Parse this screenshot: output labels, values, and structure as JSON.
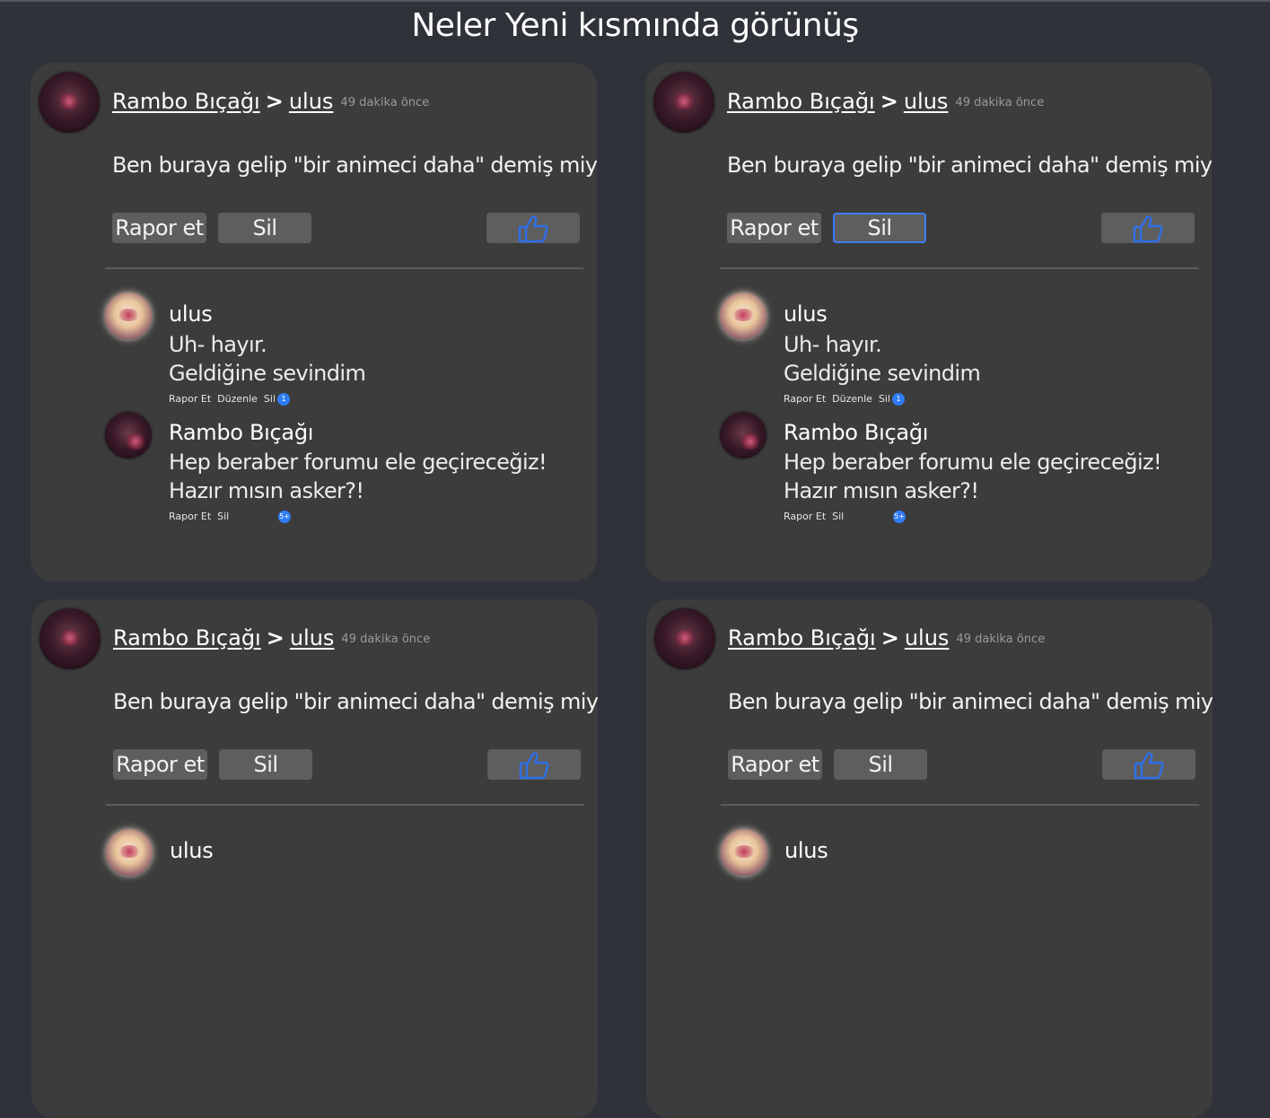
{
  "page": {
    "title": "Neler Yeni kısmında görünüş"
  },
  "colors": {
    "background": "#2f3239",
    "card": "#3c3c3c",
    "button": "#5e5e5e",
    "accent_blue": "#3f7bff",
    "badge": "#2f7cf6"
  },
  "post": {
    "author": "Rambo Bıçağı",
    "arrow": ">",
    "target": "ulus",
    "time": "49 dakika önce",
    "text": "Ben buraya gelip \"bir animeci daha\" demiş miydim?",
    "report_label": "Rapor et",
    "delete_label": "Sil",
    "like_icon": "thumbs-up-icon"
  },
  "comments": [
    {
      "author": "ulus",
      "lines": [
        "Uh- hayır.",
        "Geldiğine sevindim"
      ],
      "actions": [
        "Rapor Et",
        "Düzenle",
        "Sil"
      ],
      "badge": "1"
    },
    {
      "author": "Rambo Bıçağı",
      "lines": [
        "Hep beraber forumu ele geçireceğiz!",
        "Hazır mısın asker?!"
      ],
      "actions": [
        "Rapor Et",
        "Sil"
      ],
      "badge": "5+"
    }
  ]
}
